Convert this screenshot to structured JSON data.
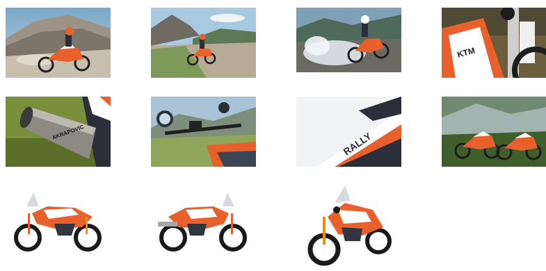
{
  "gallery": {
    "thumbnails": [
      {
        "row": 1,
        "col": 1,
        "subject": "rider-on-dirt-trail-rocky-slope"
      },
      {
        "row": 1,
        "col": 2,
        "subject": "rider-on-mountain-gravel-road"
      },
      {
        "row": 1,
        "col": 3,
        "subject": "rider-splashing-through-water"
      },
      {
        "row": 1,
        "col": 4,
        "subject": "fork-and-fender-closeup",
        "text": "KTM"
      },
      {
        "row": 2,
        "col": 1,
        "subject": "exhaust-silencer-closeup",
        "text": "AKRAPOVIC"
      },
      {
        "row": 2,
        "col": 2,
        "subject": "handlebar-cockpit-mirrors"
      },
      {
        "row": 2,
        "col": 3,
        "subject": "fuel-tank-graphics-closeup",
        "text": "RALLY"
      },
      {
        "row": 2,
        "col": 4,
        "subject": "two-bikes-in-green-meadow"
      },
      {
        "row": 3,
        "col": 1,
        "subject": "studio-bike-left-side"
      },
      {
        "row": 3,
        "col": 2,
        "subject": "studio-bike-right-side"
      },
      {
        "row": 3,
        "col": 3,
        "subject": "studio-bike-front-three-quarter"
      }
    ]
  }
}
